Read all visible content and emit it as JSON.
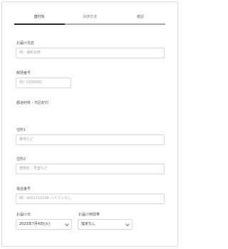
{
  "tabs": [
    {
      "label": "送付先"
    },
    {
      "label": "決済方法"
    },
    {
      "label": "確認"
    }
  ],
  "form": {
    "recipient_name": {
      "label": "お届け先名",
      "placeholder": "例）浦和太郎"
    },
    "postal_code": {
      "label": "郵便番号",
      "placeholder": "例）0300001"
    },
    "prefecture": {
      "label": "都道府県・市区町村"
    },
    "address1": {
      "label": "住所1",
      "placeholder": "番地など"
    },
    "address2": {
      "label": "住所2",
      "placeholder": "建物名・号室など"
    },
    "phone": {
      "label": "電話番号",
      "placeholder": "例）0661210248 ハイフンなし"
    },
    "delivery_date": {
      "label": "お届け日",
      "value": "2023年7月4日(火)"
    },
    "delivery_time": {
      "label": "お届け時間帯",
      "value": "指定なし"
    }
  },
  "colors": {
    "accent": "#4a9a3a",
    "active_tab": "#2b2b2b"
  }
}
